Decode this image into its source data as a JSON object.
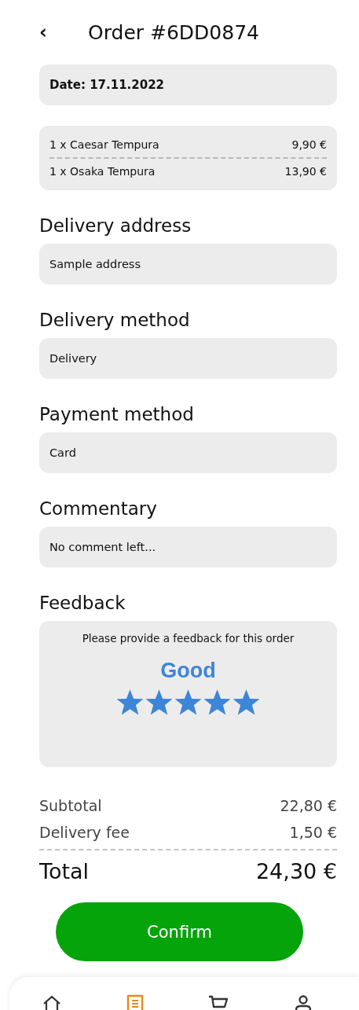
{
  "header": {
    "back": "‹",
    "title": "Order #6DD0874"
  },
  "date": "Date: 17.11.2022",
  "items": [
    {
      "name": "1 x Caesar Tempura",
      "price": "9,90 €"
    },
    {
      "name": "1 x Osaka Tempura",
      "price": "13,90 €"
    }
  ],
  "sections": [
    {
      "heading": "Delivery address",
      "value": "Sample address"
    },
    {
      "heading": "Delivery method",
      "value": "Delivery"
    },
    {
      "heading": "Payment method",
      "value": "Card"
    },
    {
      "heading": "Commentary",
      "value": "No comment left..."
    }
  ],
  "feedback": {
    "heading": "Feedback",
    "prompt": "Please provide a feedback for this order",
    "rating_label": "Good",
    "stars": 5
  },
  "totals": [
    {
      "label": "Subtotal",
      "value": "22,80 €"
    },
    {
      "label": "Delivery fee",
      "value": "1,50 €"
    }
  ],
  "total": {
    "label": "Total",
    "value": "24,30 €"
  },
  "confirm_button": "Confirm",
  "nav": [
    {
      "kind": "home",
      "selected": false
    },
    {
      "kind": "orders",
      "selected": true
    },
    {
      "kind": "cart",
      "selected": false
    },
    {
      "kind": "profile",
      "selected": false
    }
  ]
}
